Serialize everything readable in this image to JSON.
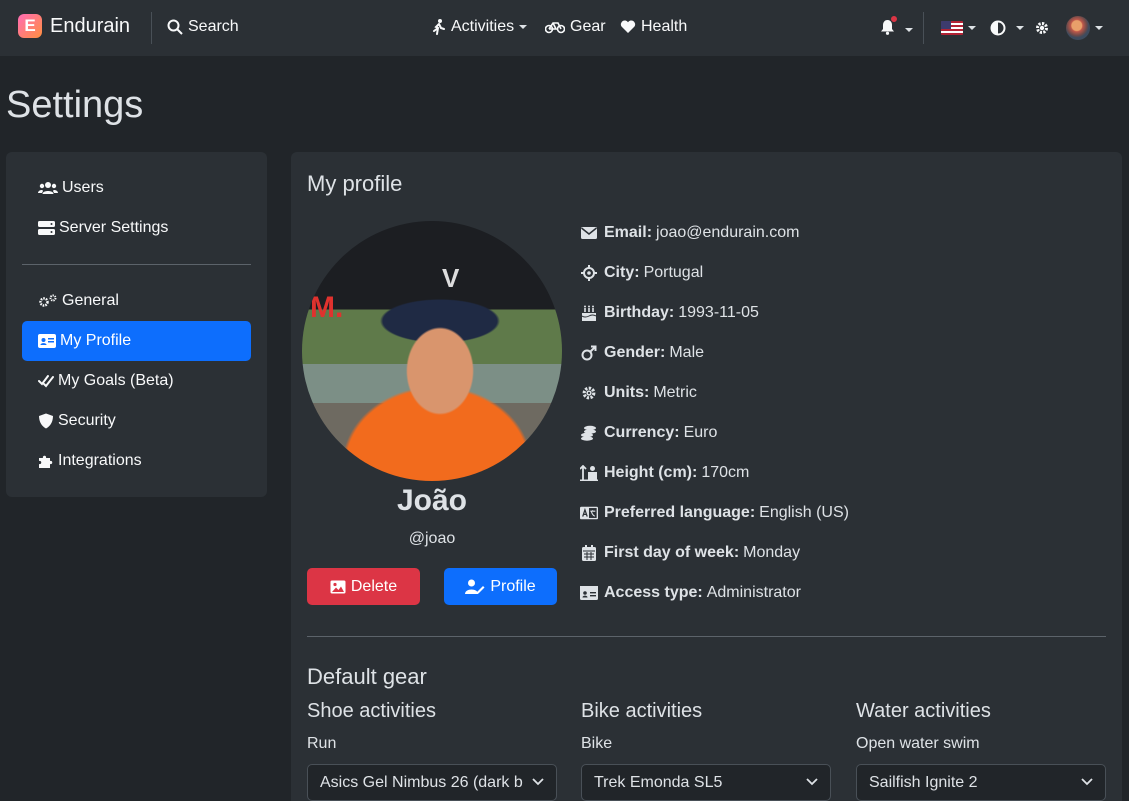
{
  "navbar": {
    "brand": "Endurain",
    "search_label": "Search",
    "activities_label": "Activities",
    "gear_label": "Gear",
    "health_label": "Health"
  },
  "page_title": "Settings",
  "sidebar": {
    "items": [
      {
        "label": "Users"
      },
      {
        "label": "Server Settings"
      },
      {
        "label": "General"
      },
      {
        "label": "My Profile"
      },
      {
        "label": "My Goals (Beta)"
      },
      {
        "label": "Security"
      },
      {
        "label": "Integrations"
      }
    ]
  },
  "profile": {
    "section_title": "My profile",
    "name": "João",
    "handle": "@joao",
    "delete_label": "Delete",
    "profile_label": "Profile",
    "info": [
      {
        "label": "Email:",
        "value": "joao@endurain.com"
      },
      {
        "label": "City:",
        "value": "Portugal"
      },
      {
        "label": "Birthday:",
        "value": "1993-11-05"
      },
      {
        "label": "Gender:",
        "value": "Male"
      },
      {
        "label": "Units:",
        "value": "Metric"
      },
      {
        "label": "Currency:",
        "value": "Euro"
      },
      {
        "label": "Height (cm):",
        "value": "170cm"
      },
      {
        "label": "Preferred language:",
        "value": "English (US)"
      },
      {
        "label": "First day of week:",
        "value": "Monday"
      },
      {
        "label": "Access type:",
        "value": "Administrator"
      }
    ]
  },
  "default_gear": {
    "title": "Default gear",
    "columns": [
      {
        "title": "Shoe activities",
        "field_label": "Run",
        "selected": "Asics Gel Nimbus 26 (dark b"
      },
      {
        "title": "Bike activities",
        "field_label": "Bike",
        "selected": "Trek Emonda SL5"
      },
      {
        "title": "Water activities",
        "field_label": "Open water swim",
        "selected": "Sailfish Ignite 2"
      }
    ]
  },
  "colors": {
    "accent": "#0d6efd",
    "danger": "#dc3545",
    "background": "#212529",
    "surface": "#2b3035"
  }
}
